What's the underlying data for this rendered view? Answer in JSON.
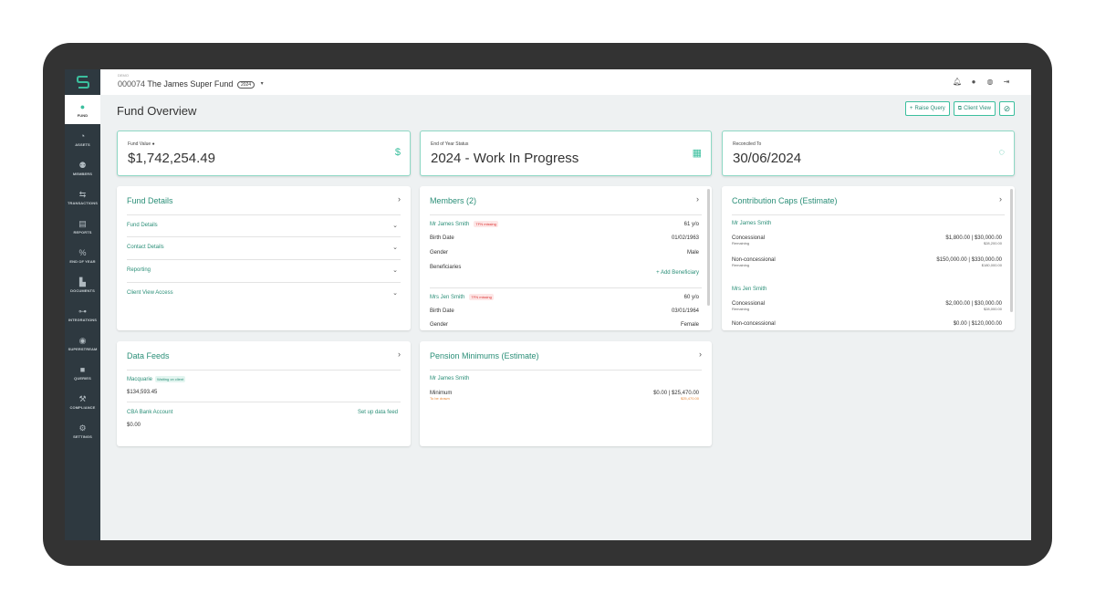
{
  "header": {
    "demo_label": "DEMO",
    "fund_number": "000074",
    "fund_name": "The James Super Fund",
    "year_badge": "2024"
  },
  "sidebar": {
    "items": [
      {
        "label": "FUND",
        "icon": "piggy-icon"
      },
      {
        "label": "ASSETS",
        "icon": "pie-icon"
      },
      {
        "label": "MEMBERS",
        "icon": "users-icon"
      },
      {
        "label": "TRANSACTIONS",
        "icon": "transactions-icon"
      },
      {
        "label": "REPORTS",
        "icon": "reports-icon"
      },
      {
        "label": "END OF YEAR",
        "icon": "percent-icon"
      },
      {
        "label": "DOCUMENTS",
        "icon": "documents-icon"
      },
      {
        "label": "INTEGRATIONS",
        "icon": "integrations-icon"
      },
      {
        "label": "SUPERSTREAM",
        "icon": "superstream-icon"
      },
      {
        "label": "QUERIES",
        "icon": "chat-icon"
      },
      {
        "label": "COMPLIANCE",
        "icon": "gavel-icon"
      },
      {
        "label": "SETTINGS",
        "icon": "gear-icon"
      }
    ]
  },
  "page": {
    "title": "Fund Overview",
    "raise_query": "Raise Query",
    "client_view": "Client View"
  },
  "stats": {
    "fund_value_label": "Fund Value",
    "fund_value": "$1,742,254.49",
    "eoy_label": "End of Year Status",
    "eoy_value": "2024 - Work In Progress",
    "reconciled_label": "Reconciled To",
    "reconciled_value": "30/06/2024"
  },
  "fund_details": {
    "title": "Fund Details",
    "items": [
      "Fund Details",
      "Contact Details",
      "Reporting",
      "Client View Access"
    ]
  },
  "members": {
    "title": "Members (2)",
    "list": [
      {
        "name": "Mr James Smith",
        "badge": "TFN missing",
        "age": "61 y/o",
        "birth_label": "Birth Date",
        "birth": "01/02/1963",
        "gender_label": "Gender",
        "gender": "Male",
        "beneficiaries_label": "Beneficiaries",
        "add_beneficiary": "Add Beneficiary"
      },
      {
        "name": "Mrs Jen Smith",
        "badge": "TFN missing",
        "age": "60 y/o",
        "birth_label": "Birth Date",
        "birth": "03/01/1964",
        "gender_label": "Gender",
        "gender": "Female"
      }
    ]
  },
  "caps": {
    "title": "Contribution Caps (Estimate)",
    "members": [
      {
        "name": "Mr James Smith",
        "rows": [
          {
            "label": "Concessional",
            "sub": "Remaining",
            "value": "$1,800.00 | $30,000.00",
            "remaining": "$28,200.00"
          },
          {
            "label": "Non-concessional",
            "sub": "Remaining",
            "value": "$150,000.00 | $330,000.00",
            "remaining": "$180,000.00"
          }
        ]
      },
      {
        "name": "Mrs Jen Smith",
        "rows": [
          {
            "label": "Concessional",
            "sub": "Remaining",
            "value": "$2,000.00 | $30,000.00",
            "remaining": "$28,000.00"
          },
          {
            "label": "Non-concessional",
            "value": "$0.00 | $120,000.00"
          }
        ]
      }
    ]
  },
  "data_feeds": {
    "title": "Data Feeds",
    "feeds": [
      {
        "name": "Macquarie",
        "badge": "Waiting on client",
        "amount": "$134,593.45"
      },
      {
        "name": "CBA Bank Account",
        "action": "Set up data feed",
        "amount": "$0.00"
      }
    ]
  },
  "pension": {
    "title": "Pension Minimums (Estimate)",
    "member": "Mr James Smith",
    "label": "Minimum",
    "sub": "To be drawn",
    "value": "$0.00 | $25,470.00",
    "to_draw": "$25,470.00"
  },
  "colors": {
    "accent": "#3bbf9e",
    "sidebar": "#2e3940",
    "link": "#2b8f78"
  }
}
